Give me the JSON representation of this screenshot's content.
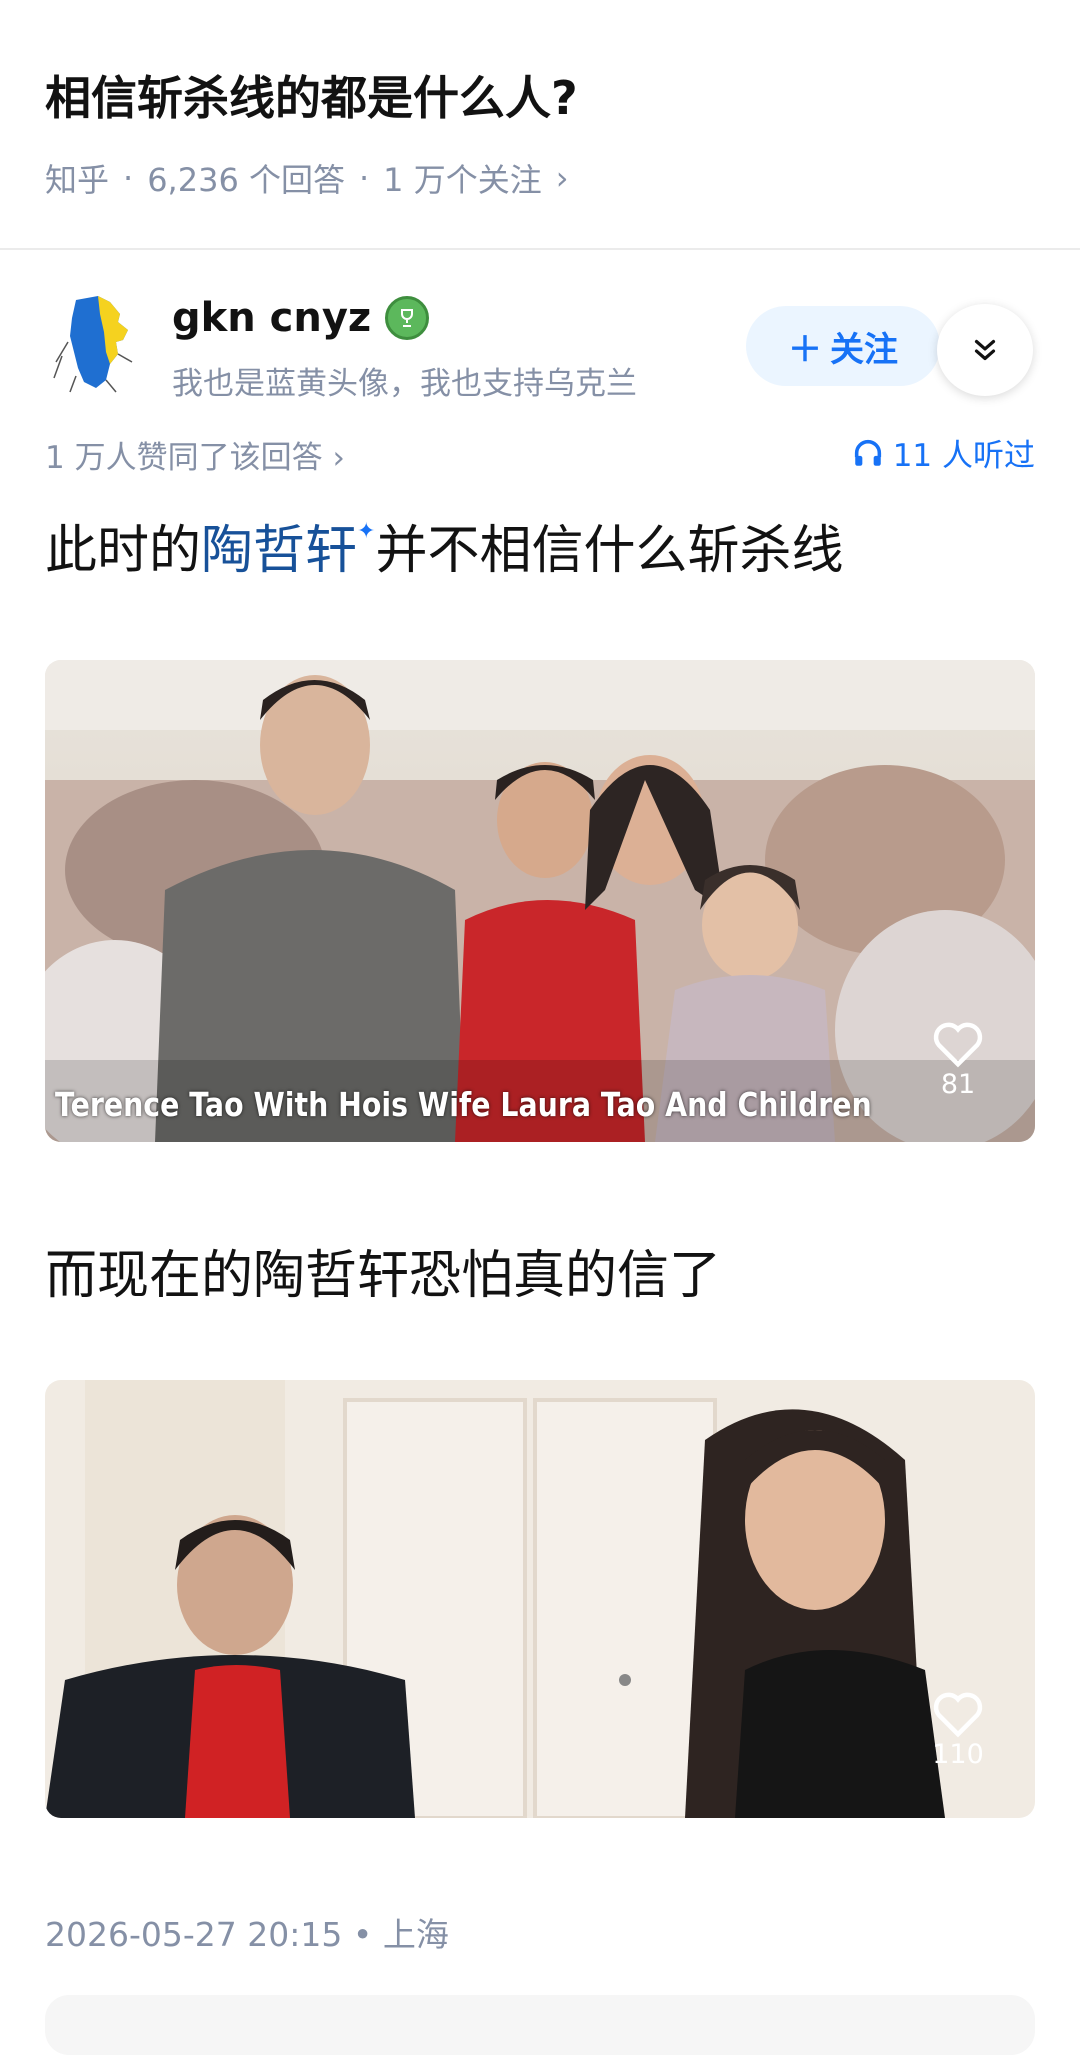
{
  "question": {
    "title": "相信斩杀线的都是什么人?",
    "source": "知乎",
    "answers": "6,236 个回答",
    "followers": "1 万个关注",
    "chevron": "›"
  },
  "author": {
    "name": "gkn cnyz",
    "bio": "我也是蓝黄头像，我也支持乌克兰",
    "follow_label": "关注",
    "avatar_colors": [
      "#1f6fd1",
      "#f5d21f"
    ]
  },
  "stats": {
    "upvotes": "1 万人赞同了该回答",
    "listened": "11 人听过"
  },
  "content": {
    "para1_pre": "此时的",
    "para1_keyword": "陶哲轩",
    "para1_post": "并不相信什么斩杀线",
    "photo1_caption": "Terence Tao With Hois Wife Laura Tao And Children",
    "photo1_likes": "81",
    "para2": "而现在的陶哲轩恐怕真的信了",
    "photo2_likes": "110"
  },
  "footer": {
    "datetime": "2026-05-27 20:15",
    "location": "上海"
  },
  "colors": {
    "accent": "#1772f6",
    "keyword": "#175199",
    "meta": "#8590a6"
  }
}
